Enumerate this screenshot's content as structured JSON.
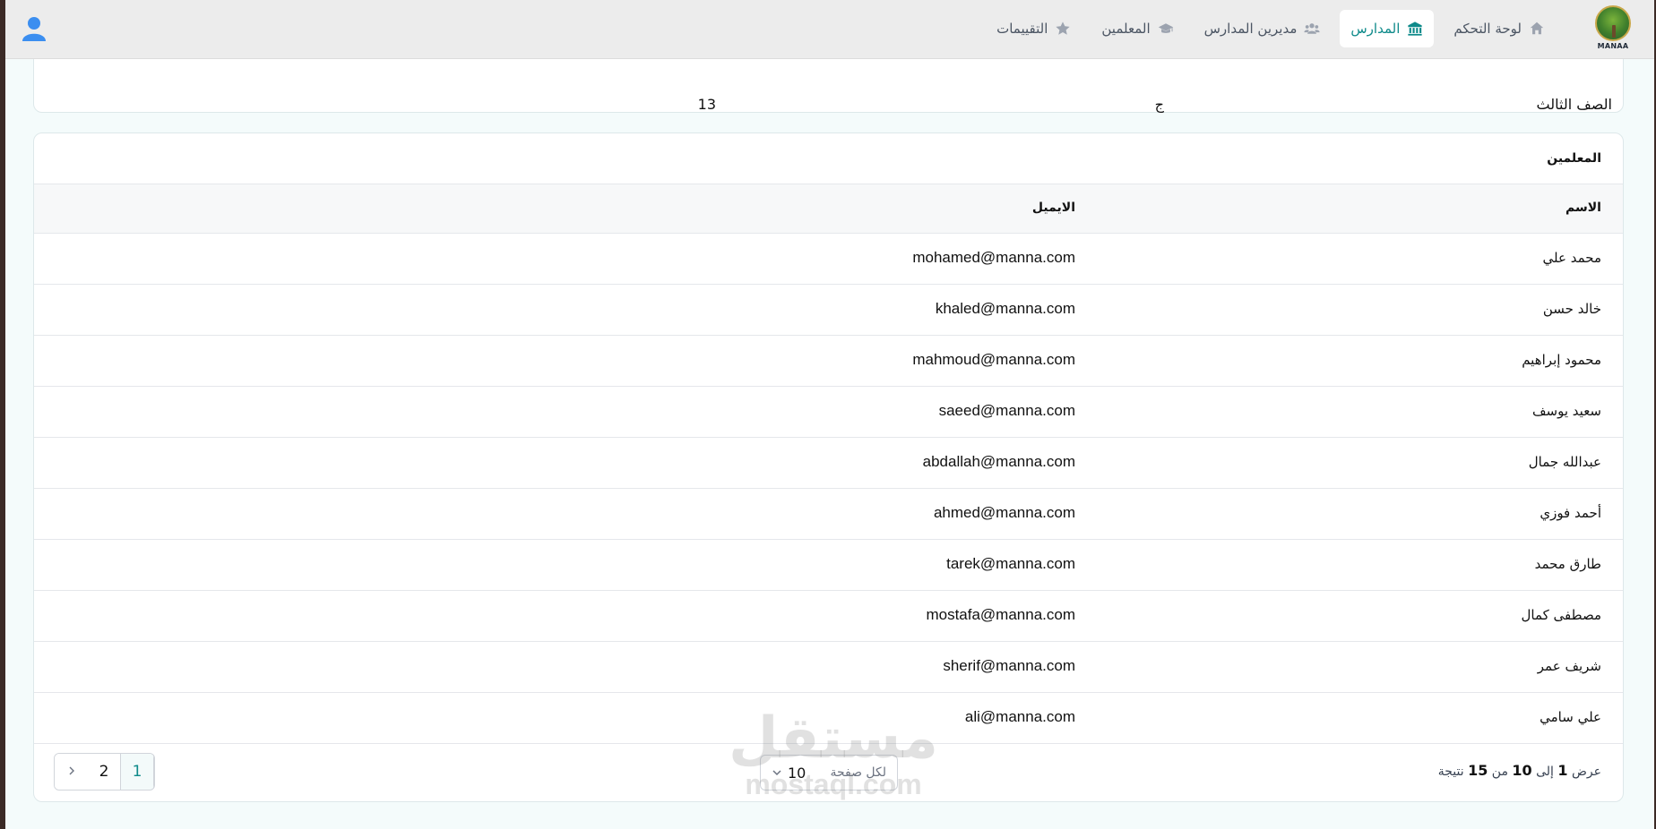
{
  "brand": {
    "logo_text": "MANAA"
  },
  "nav": {
    "items": [
      {
        "label": "لوحة التحكم",
        "icon": "home-icon"
      },
      {
        "label": "المدارس",
        "icon": "school-icon",
        "active": true
      },
      {
        "label": "مديرين المدارس",
        "icon": "users-icon"
      },
      {
        "label": "المعلمين",
        "icon": "graduation-cap-icon"
      },
      {
        "label": "التقييمات",
        "icon": "star-icon"
      }
    ]
  },
  "class_card": {
    "row": {
      "class_name": "الصف الثالث",
      "section": "ج",
      "students_count": "13"
    }
  },
  "teachers": {
    "title": "المعلمين",
    "columns": {
      "name": "الاسم",
      "email": "الايميل"
    },
    "rows": [
      {
        "name": "محمد علي",
        "email": "mohamed@manna.com"
      },
      {
        "name": "خالد حسن",
        "email": "khaled@manna.com"
      },
      {
        "name": "محمود إبراهيم",
        "email": "mahmoud@manna.com"
      },
      {
        "name": "سعيد يوسف",
        "email": "saeed@manna.com"
      },
      {
        "name": "عبدالله جمال",
        "email": "abdallah@manna.com"
      },
      {
        "name": "أحمد فوزي",
        "email": "ahmed@manna.com"
      },
      {
        "name": "طارق محمد",
        "email": "tarek@manna.com"
      },
      {
        "name": "مصطفى كمال",
        "email": "mostafa@manna.com"
      },
      {
        "name": "شريف عمر",
        "email": "sherif@manna.com"
      },
      {
        "name": "علي سامي",
        "email": "ali@manna.com"
      }
    ]
  },
  "pagination": {
    "summary_prefix": "عرض",
    "from": "1",
    "to_word": "إلى",
    "to": "10",
    "of_word": "من",
    "total": "15",
    "suffix": "نتيجة",
    "per_page_label": "لكل صفحة",
    "per_page_value": "10",
    "pages": [
      "1",
      "2"
    ],
    "current_page": "1"
  },
  "watermark": {
    "ar": "مستقل",
    "en": "mostaql.com"
  },
  "colors": {
    "accent": "#0e8a8a",
    "user_icon": "#3b8ef0",
    "topbar": "#ececec"
  }
}
